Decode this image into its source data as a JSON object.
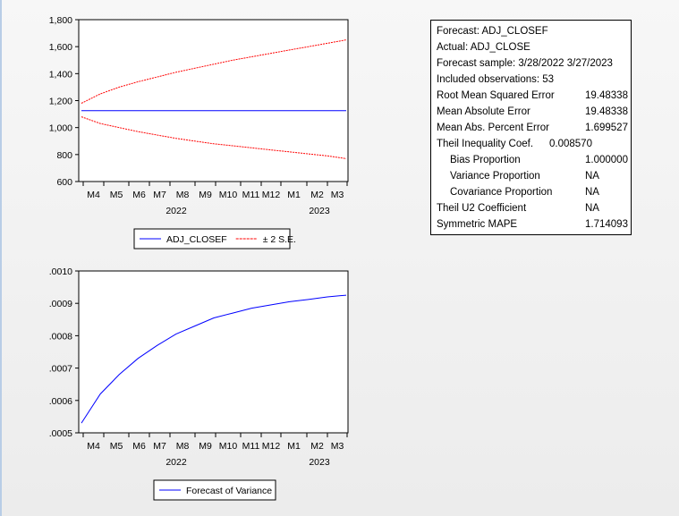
{
  "chart_data": [
    {
      "type": "line",
      "title": "",
      "x_months": [
        "M4",
        "M5",
        "M6",
        "M7",
        "M8",
        "M9",
        "M10",
        "M11",
        "M12",
        "M1",
        "M2",
        "M3"
      ],
      "x_years": [
        "2022",
        "2023"
      ],
      "ylim": [
        600,
        1800
      ],
      "yticks": [
        "1,800",
        "1,600",
        "1,400",
        "1,200",
        "1,000",
        "800",
        "600"
      ],
      "ytick_values": [
        1800,
        1600,
        1400,
        1200,
        1000,
        800,
        600
      ],
      "series": [
        {
          "name": "ADJ_CLOSEF",
          "color": "#0000ff",
          "style": "solid",
          "values": [
            1125,
            1125,
            1125,
            1125,
            1125,
            1125,
            1125,
            1125,
            1125,
            1125,
            1125,
            1125,
            1125,
            1125,
            1125
          ]
        },
        {
          "name": "± 2 S.E.",
          "color": "#ff0000",
          "style": "dashed",
          "values": [
            1180,
            1250,
            1300,
            1340,
            1375,
            1410,
            1440,
            1470,
            1500,
            1525,
            1550,
            1575,
            1600,
            1625,
            1650
          ]
        },
        {
          "name": "± 2 S.E. lower",
          "color": "#ff0000",
          "style": "dashed",
          "values": [
            1080,
            1030,
            1000,
            970,
            945,
            920,
            900,
            880,
            865,
            850,
            835,
            820,
            805,
            790,
            770
          ]
        }
      ],
      "legend": [
        "ADJ_CLOSEF",
        "± 2 S.E."
      ],
      "legend_placement": "bottom"
    },
    {
      "type": "line",
      "x_months": [
        "M4",
        "M5",
        "M6",
        "M7",
        "M8",
        "M9",
        "M10",
        "M11",
        "M12",
        "M1",
        "M2",
        "M3"
      ],
      "x_years": [
        "2022",
        "2023"
      ],
      "ylim": [
        0.0005,
        0.001
      ],
      "yticks": [
        ".0010",
        ".0009",
        ".0008",
        ".0007",
        ".0006",
        ".0005"
      ],
      "ytick_values": [
        0.001,
        0.0009,
        0.0008,
        0.0007,
        0.0006,
        0.0005
      ],
      "series": [
        {
          "name": "Forecast of Variance",
          "color": "#0000ff",
          "style": "solid",
          "values": [
            0.00053,
            0.00062,
            0.00068,
            0.00073,
            0.00077,
            0.000805,
            0.00083,
            0.000855,
            0.00087,
            0.000885,
            0.000895,
            0.000905,
            0.000912,
            0.00092,
            0.000925
          ]
        }
      ],
      "legend": [
        "Forecast of Variance"
      ],
      "legend_placement": "bottom"
    }
  ],
  "stats": {
    "forecast": "Forecast: ADJ_CLOSEF",
    "actual": "Actual: ADJ_CLOSE",
    "sample": "Forecast sample: 3/28/2022 3/27/2023",
    "obs": "Included observations: 53",
    "rows": [
      {
        "label": "Root Mean Squared Error",
        "value": "19.48338",
        "cls": ""
      },
      {
        "label": "Mean Absolute Error",
        "value": "19.48338",
        "cls": ""
      },
      {
        "label": "Mean Abs. Percent Error",
        "value": "1.699527",
        "cls": ""
      },
      {
        "label": "Theil Inequality Coef.",
        "value": "0.008570",
        "cls": "theil"
      },
      {
        "label": "Bias Proportion",
        "value": "1.000000",
        "cls": "ind"
      },
      {
        "label": "Variance Proportion",
        "value": "NA",
        "cls": "ind"
      },
      {
        "label": "Covariance Proportion",
        "value": "NA",
        "cls": "ind"
      },
      {
        "label": "Theil U2 Coefficient",
        "value": "NA",
        "cls": ""
      },
      {
        "label": "Symmetric MAPE",
        "value": "1.714093",
        "cls": ""
      }
    ]
  }
}
